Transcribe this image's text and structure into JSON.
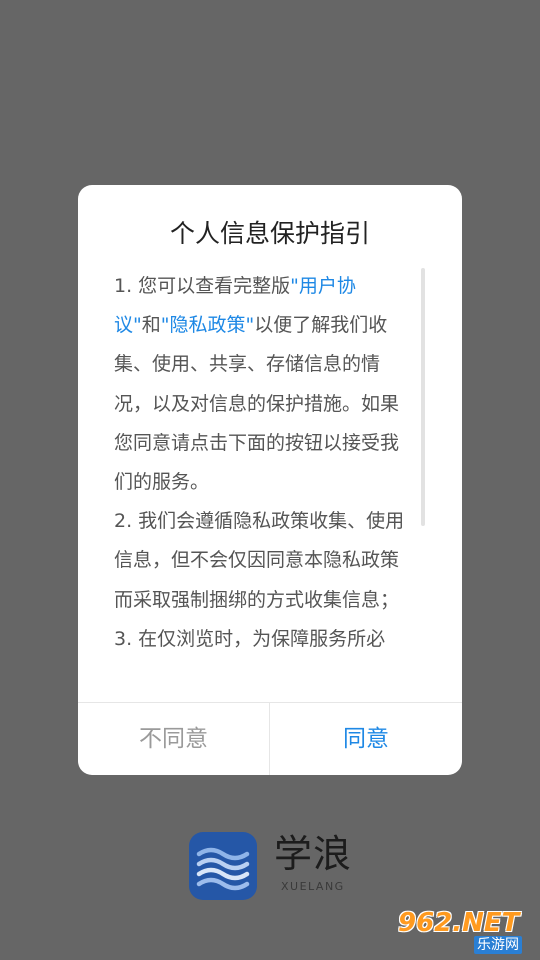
{
  "colors": {
    "overlay": "#666666",
    "dialog_bg": "#ffffff",
    "link": "#1e88e5",
    "logo_bg": "#2557a7"
  },
  "dialog": {
    "title": "个人信息保护指引",
    "body": {
      "p1_prefix": "1. 您可以查看完整版",
      "q1_open": "\"",
      "link_user_agreement": "用户协议",
      "q1_close": "\"",
      "and_text": "和",
      "q2_open": "\"",
      "link_privacy_policy": "隐私政策",
      "q2_close": "\"",
      "p1_suffix": "以便了解我们收集、使用、共享、存储信息的情况，以及对信息的保护措施。如果您同意请点击下面的按钮以接受我们的服务。",
      "p2": "2. 我们会遵循隐私政策收集、使用信息，但不会仅因同意本隐私政策而采取强制捆绑的方式收集信息；",
      "p3": "3. 在仅浏览时，为保障服务所必"
    },
    "buttons": {
      "disagree": "不同意",
      "agree": "同意"
    }
  },
  "brand": {
    "name": "学浪",
    "subtitle": "XUELANG",
    "logo_icon": "wave-logo-icon"
  },
  "watermark": {
    "top": "962.NET",
    "bottom": "乐游网"
  }
}
